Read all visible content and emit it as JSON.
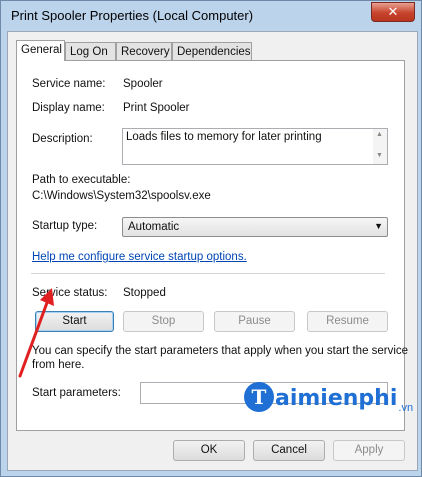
{
  "window": {
    "title": "Print Spooler Properties (Local Computer)",
    "close_glyph": "✕"
  },
  "tabs": [
    {
      "label": "General",
      "active": true
    },
    {
      "label": "Log On",
      "active": false
    },
    {
      "label": "Recovery",
      "active": false
    },
    {
      "label": "Dependencies",
      "active": false
    }
  ],
  "general": {
    "service_name_label": "Service name:",
    "service_name_value": "Spooler",
    "display_name_label": "Display name:",
    "display_name_value": "Print Spooler",
    "description_label": "Description:",
    "description_value": "Loads files to memory for later printing",
    "path_label": "Path to executable:",
    "path_value": "C:\\Windows\\System32\\spoolsv.exe",
    "startup_type_label": "Startup type:",
    "startup_type_value": "Automatic",
    "help_link": "Help me configure service startup options.",
    "service_status_label": "Service status:",
    "service_status_value": "Stopped",
    "buttons": {
      "start": "Start",
      "stop": "Stop",
      "pause": "Pause",
      "resume": "Resume"
    },
    "hint_line1": "You can specify the start parameters that apply when you start the service",
    "hint_line2": "from here.",
    "start_params_label": "Start parameters:",
    "start_params_value": ""
  },
  "dialog_buttons": {
    "ok": "OK",
    "cancel": "Cancel",
    "apply": "Apply"
  },
  "watermark": {
    "logo_letter": "T",
    "text": "aimienphi",
    "suffix": ".vn"
  },
  "colors": {
    "annotation_arrow": "#e02020",
    "link": "#0045b5",
    "watermark": "#1f6fd4"
  }
}
